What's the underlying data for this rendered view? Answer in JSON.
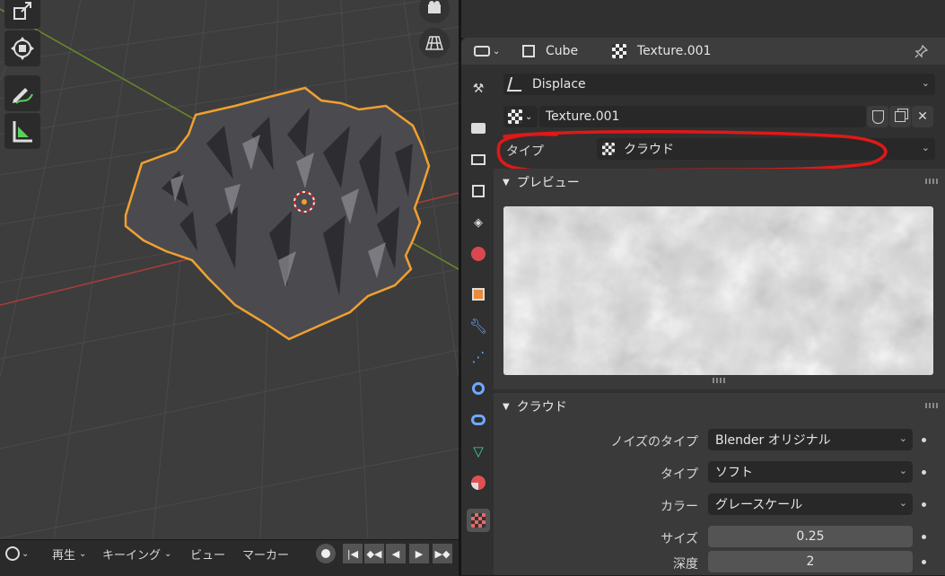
{
  "viewport": {
    "name": "3d-viewport"
  },
  "timeline": {
    "play_label": "再生",
    "keying_label": "キーイング",
    "view_label": "ビュー",
    "marker_label": "マーカー"
  },
  "properties": {
    "object_name": "Cube",
    "texture_name": "Texture.001",
    "modifier_dropdown": "Displace",
    "texture_field": "Texture.001",
    "type_label": "タイプ",
    "type_value": "クラウド",
    "preview_section": "プレビュー",
    "clouds_section": "クラウド",
    "props": [
      {
        "label": "ノイズのタイプ",
        "value": "Blender オリジナル",
        "kind": "dropdown"
      },
      {
        "label": "タイプ",
        "value": "ソフト",
        "kind": "dropdown"
      },
      {
        "label": "カラー",
        "value": "グレースケール",
        "kind": "dropdown"
      },
      {
        "label": "サイズ",
        "value": "0.25",
        "kind": "number"
      },
      {
        "label": "深度",
        "value": "2",
        "kind": "number"
      }
    ]
  },
  "colors": {
    "selection_outline": "#f0a030",
    "annotation_red": "#e01818",
    "x_axis": "#a83c3c",
    "y_axis": "#6b8a2c"
  }
}
